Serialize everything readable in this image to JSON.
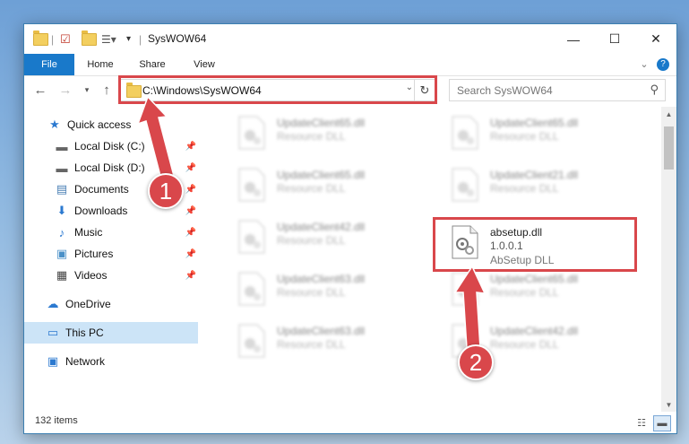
{
  "window": {
    "title": "SysWOW64"
  },
  "ribbon": {
    "tabs": [
      "File",
      "Home",
      "Share",
      "View"
    ]
  },
  "address": {
    "path": "C:\\Windows\\SysWOW64"
  },
  "search": {
    "placeholder": "Search SysWOW64"
  },
  "nav": {
    "items": [
      {
        "label": "Quick access",
        "icon": "star-icon",
        "pinned": false
      },
      {
        "label": "Local Disk (C:)",
        "icon": "drive-icon",
        "pinned": true
      },
      {
        "label": "Local Disk (D:)",
        "icon": "drive-icon",
        "pinned": true
      },
      {
        "label": "Documents",
        "icon": "documents-icon",
        "pinned": true
      },
      {
        "label": "Downloads",
        "icon": "download-icon",
        "pinned": true
      },
      {
        "label": "Music",
        "icon": "music-icon",
        "pinned": true
      },
      {
        "label": "Pictures",
        "icon": "pictures-icon",
        "pinned": true
      },
      {
        "label": "Videos",
        "icon": "videos-icon",
        "pinned": true
      },
      {
        "label": "OneDrive",
        "icon": "cloud-icon",
        "pinned": false
      },
      {
        "label": "This PC",
        "icon": "computer-icon",
        "pinned": false
      },
      {
        "label": "Network",
        "icon": "network-icon",
        "pinned": false
      }
    ]
  },
  "files": [
    {
      "name": "UpdateClient65.dll",
      "desc": "Resource DLL"
    },
    {
      "name": "UpdateClient65.dll",
      "desc": "Resource DLL"
    },
    {
      "name": "UpdateClient65.dll",
      "desc": "Resource DLL"
    },
    {
      "name": "UpdateClient21.dll",
      "desc": "Resource DLL"
    },
    {
      "name": "UpdateClient42.dll",
      "desc": "Resource DLL"
    },
    {
      "name": "absetup.dll",
      "version": "1.0.0.1",
      "desc": "AbSetup DLL"
    },
    {
      "name": "UpdateClient63.dll",
      "desc": "Resource DLL"
    },
    {
      "name": "UpdateClient65.dll",
      "desc": "Resource DLL"
    },
    {
      "name": "UpdateClient63.dll",
      "desc": "Resource DLL"
    },
    {
      "name": "UpdateClient42.dll",
      "desc": "Resource DLL"
    }
  ],
  "status": {
    "count": "132 items"
  },
  "annotations": {
    "step1": "1",
    "step2": "2",
    "color": "#d9474b"
  }
}
